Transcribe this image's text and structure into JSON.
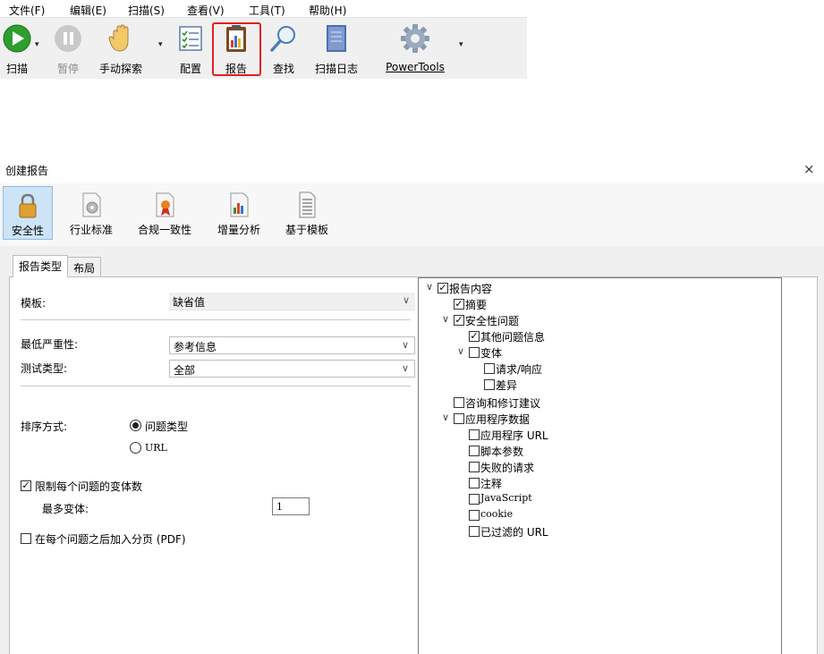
{
  "app": {
    "menu": [
      "文件(F)",
      "编辑(E)",
      "扫描(S)",
      "查看(V)",
      "工具(T)",
      "帮助(H)"
    ],
    "toolbar": {
      "scan": "扫描",
      "pause": "暂停",
      "manual_explore": "手动探索",
      "config": "配置",
      "report": "报告",
      "find": "查找",
      "scan_log": "扫描日志",
      "powertools": "PowerTools"
    }
  },
  "dialog": {
    "title": "创建报告",
    "close": "×",
    "categories": [
      "安全性",
      "行业标准",
      "合规一致性",
      "增量分析",
      "基于模板"
    ],
    "tabs": [
      "报告类型",
      "布局"
    ],
    "form": {
      "template_label": "模板:",
      "template_value": "缺省值",
      "min_severity_label": "最低严重性:",
      "min_severity_value": "参考信息",
      "test_type_label": "测试类型:",
      "test_type_value": "全部",
      "sort_label": "排序方式:",
      "sort_option_issue_type": "问题类型",
      "sort_option_url": "URL",
      "limit_variants_label": "限制每个问题的变体数",
      "max_variants_label": "最多变体:",
      "max_variants_value": "1",
      "page_break_label": "在每个问题之后加入分页 (PDF)"
    },
    "tree": {
      "report_content": "报告内容",
      "summary": "摘要",
      "security_issues": "安全性问题",
      "other_issue_info": "其他问题信息",
      "variants": "变体",
      "request_response": "请求/响应",
      "diff": "差异",
      "advisory_fix": "咨询和修订建议",
      "app_data": "应用程序数据",
      "app_url": "应用程序 URL",
      "script_params": "脚本参数",
      "failed_requests": "失败的请求",
      "comments": "注释",
      "javascript": "JavaScript",
      "cookie": "cookie",
      "filtered_url": "已过滤的 URL"
    }
  },
  "colors": {
    "highlight": "#e02020",
    "selected_category": "#cde4f7",
    "play_green": "#2e9e2e"
  }
}
